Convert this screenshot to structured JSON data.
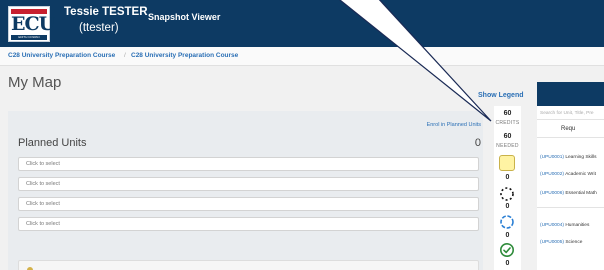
{
  "header": {
    "logo_text": "ECU",
    "logo_subtext": "EDITH COWAN",
    "user_name": "Tessie TESTER",
    "user_id": "(ttester)",
    "app_title": "Snapshot Viewer"
  },
  "breadcrumb": {
    "items": [
      "C28 University Preparation Course",
      "C28 University Preparation Course"
    ],
    "separator": "/"
  },
  "page": {
    "title": "My Map",
    "show_legend": "Show Legend"
  },
  "planned": {
    "enrol_link": "Enrol in Planned Units",
    "label": "Planned Units",
    "count": "0",
    "slots": [
      "Click to select",
      "Click to select",
      "Click to select",
      "Click to select"
    ]
  },
  "credits": {
    "credits_value": "60",
    "credits_label": "CREDITS",
    "needed_value": "60",
    "needed_label": "NEEDED",
    "status_counts": [
      "0",
      "0",
      "0",
      "0"
    ]
  },
  "right_panel": {
    "search_placeholder": "Search for Unit, Title, Pre",
    "req_header": "Requ",
    "units": [
      {
        "code": "(UPU0001)",
        "title": "Learning Skills"
      },
      {
        "code": "(UPU0002)",
        "title": "Academic Writ"
      },
      {
        "code": "(UPU0006)",
        "title": "Essential Math"
      },
      {
        "code": "(UPU0004)",
        "title": "Humanities"
      },
      {
        "code": "(UPU0005)",
        "title": "Science"
      }
    ]
  },
  "colors": {
    "brand_navy": "#0d3a63",
    "link_blue": "#2a6fb5",
    "complete_green": "#2e8b3a",
    "enrolled_blue": "#2a7fd4"
  }
}
